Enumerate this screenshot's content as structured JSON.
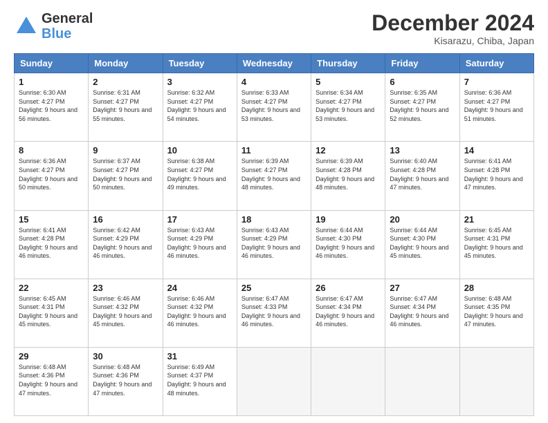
{
  "header": {
    "logo_general": "General",
    "logo_blue": "Blue",
    "month_title": "December 2024",
    "location": "Kisarazu, Chiba, Japan"
  },
  "calendar": {
    "headers": [
      "Sunday",
      "Monday",
      "Tuesday",
      "Wednesday",
      "Thursday",
      "Friday",
      "Saturday"
    ],
    "weeks": [
      [
        null,
        null,
        null,
        null,
        null,
        null,
        null
      ]
    ],
    "days": [
      {
        "date": 1,
        "sunrise": "6:30 AM",
        "sunset": "4:27 PM",
        "daylight": "9 hours and 56 minutes."
      },
      {
        "date": 2,
        "sunrise": "6:31 AM",
        "sunset": "4:27 PM",
        "daylight": "9 hours and 55 minutes."
      },
      {
        "date": 3,
        "sunrise": "6:32 AM",
        "sunset": "4:27 PM",
        "daylight": "9 hours and 54 minutes."
      },
      {
        "date": 4,
        "sunrise": "6:33 AM",
        "sunset": "4:27 PM",
        "daylight": "9 hours and 53 minutes."
      },
      {
        "date": 5,
        "sunrise": "6:34 AM",
        "sunset": "4:27 PM",
        "daylight": "9 hours and 53 minutes."
      },
      {
        "date": 6,
        "sunrise": "6:35 AM",
        "sunset": "4:27 PM",
        "daylight": "9 hours and 52 minutes."
      },
      {
        "date": 7,
        "sunrise": "6:36 AM",
        "sunset": "4:27 PM",
        "daylight": "9 hours and 51 minutes."
      },
      {
        "date": 8,
        "sunrise": "6:36 AM",
        "sunset": "4:27 PM",
        "daylight": "9 hours and 50 minutes."
      },
      {
        "date": 9,
        "sunrise": "6:37 AM",
        "sunset": "4:27 PM",
        "daylight": "9 hours and 50 minutes."
      },
      {
        "date": 10,
        "sunrise": "6:38 AM",
        "sunset": "4:27 PM",
        "daylight": "9 hours and 49 minutes."
      },
      {
        "date": 11,
        "sunrise": "6:39 AM",
        "sunset": "4:27 PM",
        "daylight": "9 hours and 48 minutes."
      },
      {
        "date": 12,
        "sunrise": "6:39 AM",
        "sunset": "4:28 PM",
        "daylight": "9 hours and 48 minutes."
      },
      {
        "date": 13,
        "sunrise": "6:40 AM",
        "sunset": "4:28 PM",
        "daylight": "9 hours and 47 minutes."
      },
      {
        "date": 14,
        "sunrise": "6:41 AM",
        "sunset": "4:28 PM",
        "daylight": "9 hours and 47 minutes."
      },
      {
        "date": 15,
        "sunrise": "6:41 AM",
        "sunset": "4:28 PM",
        "daylight": "9 hours and 46 minutes."
      },
      {
        "date": 16,
        "sunrise": "6:42 AM",
        "sunset": "4:29 PM",
        "daylight": "9 hours and 46 minutes."
      },
      {
        "date": 17,
        "sunrise": "6:43 AM",
        "sunset": "4:29 PM",
        "daylight": "9 hours and 46 minutes."
      },
      {
        "date": 18,
        "sunrise": "6:43 AM",
        "sunset": "4:29 PM",
        "daylight": "9 hours and 46 minutes."
      },
      {
        "date": 19,
        "sunrise": "6:44 AM",
        "sunset": "4:30 PM",
        "daylight": "9 hours and 46 minutes."
      },
      {
        "date": 20,
        "sunrise": "6:44 AM",
        "sunset": "4:30 PM",
        "daylight": "9 hours and 45 minutes."
      },
      {
        "date": 21,
        "sunrise": "6:45 AM",
        "sunset": "4:31 PM",
        "daylight": "9 hours and 45 minutes."
      },
      {
        "date": 22,
        "sunrise": "6:45 AM",
        "sunset": "4:31 PM",
        "daylight": "9 hours and 45 minutes."
      },
      {
        "date": 23,
        "sunrise": "6:46 AM",
        "sunset": "4:32 PM",
        "daylight": "9 hours and 45 minutes."
      },
      {
        "date": 24,
        "sunrise": "6:46 AM",
        "sunset": "4:32 PM",
        "daylight": "9 hours and 46 minutes."
      },
      {
        "date": 25,
        "sunrise": "6:47 AM",
        "sunset": "4:33 PM",
        "daylight": "9 hours and 46 minutes."
      },
      {
        "date": 26,
        "sunrise": "6:47 AM",
        "sunset": "4:34 PM",
        "daylight": "9 hours and 46 minutes."
      },
      {
        "date": 27,
        "sunrise": "6:47 AM",
        "sunset": "4:34 PM",
        "daylight": "9 hours and 46 minutes."
      },
      {
        "date": 28,
        "sunrise": "6:48 AM",
        "sunset": "4:35 PM",
        "daylight": "9 hours and 47 minutes."
      },
      {
        "date": 29,
        "sunrise": "6:48 AM",
        "sunset": "4:36 PM",
        "daylight": "9 hours and 47 minutes."
      },
      {
        "date": 30,
        "sunrise": "6:48 AM",
        "sunset": "4:36 PM",
        "daylight": "9 hours and 47 minutes."
      },
      {
        "date": 31,
        "sunrise": "6:49 AM",
        "sunset": "4:37 PM",
        "daylight": "9 hours and 48 minutes."
      }
    ]
  }
}
